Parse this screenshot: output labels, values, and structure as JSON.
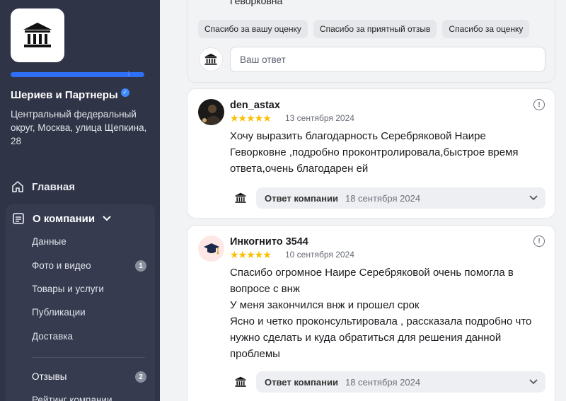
{
  "sidebar": {
    "company_name": "Шериев и Партнеры",
    "address": "Центральный федеральный округ, Москва, улица Щепкина, 28",
    "nav_home": "Главная",
    "nav_about": "О компании",
    "items": [
      {
        "label": "Данные"
      },
      {
        "label": "Фото и видео",
        "badge": "1"
      },
      {
        "label": "Товары и услуги"
      },
      {
        "label": "Публикации"
      },
      {
        "label": "Доставка"
      },
      {
        "label": "Отзывы",
        "badge": "2"
      },
      {
        "label": "Рейтинг компании"
      }
    ]
  },
  "top_card": {
    "text": "Геворковна",
    "chips": [
      "Спасибо за вашу оценку",
      "Спасибо за приятный отзыв",
      "Спасибо за оценку"
    ],
    "reply_placeholder": "Ваш ответ"
  },
  "reviews": [
    {
      "author": "den_astax",
      "stars": "★★★★★",
      "date": "13 сентября 2024",
      "lines": [
        "Хочу выразить благодарность Серебряковой Наире",
        "Геворковне ,подробно проконтролировала,быстрое время",
        "ответа,очень благодарен ей"
      ],
      "answer_label": "Ответ компании",
      "answer_date": "18 сентября 2024"
    },
    {
      "author": "Инкогнито 3544",
      "stars": "★★★★★",
      "date": "10 сентября 2024",
      "lines": [
        "Спасибо огромное Наире Серебряковой очень помогла в",
        "вопросе с внж",
        "У меня закончился внж и прошел срок",
        "Ясно и четко проконсультировала , рассказала подробно что",
        "нужно сделать и куда обратиться для решения данной",
        "проблемы"
      ],
      "answer_label": "Ответ компании",
      "answer_date": "18 сентября 2024"
    }
  ],
  "colors": {
    "sidebar": "#2f3447",
    "accent": "#2f6ff5",
    "star": "#fbbf00"
  }
}
